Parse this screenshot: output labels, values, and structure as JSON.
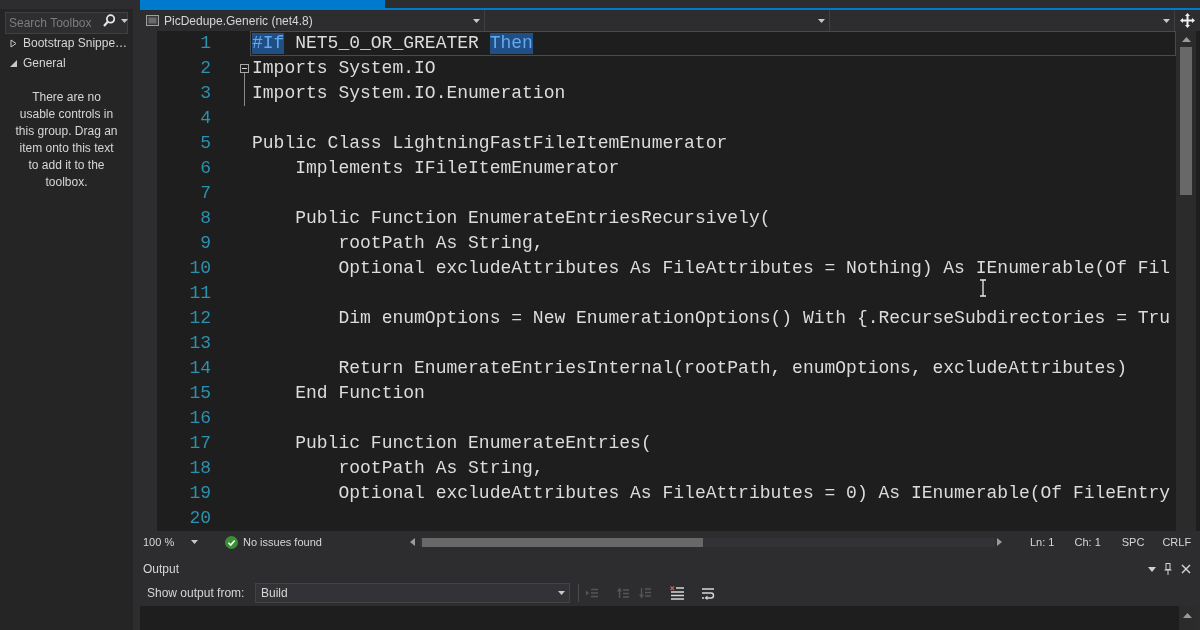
{
  "toolbox": {
    "search": {
      "placeholder": "Search Toolbox"
    },
    "groups": [
      {
        "label": "Bootstrap Snippe…",
        "expanded": false
      },
      {
        "label": "General",
        "expanded": true
      }
    ],
    "empty_message": "There are no usable controls in this group. Drag an item onto this text to add it to the toolbox."
  },
  "navigation_bar": {
    "project": "PicDedupe.Generic (net4.8)"
  },
  "editor": {
    "lines": [
      {
        "number": "1",
        "current": true,
        "segments": [
          {
            "text": "#If",
            "highlighted": true
          },
          {
            "text": "NET5_0_OR_GREATER",
            "highlighted": false
          },
          {
            "text": "Then",
            "highlighted": true
          }
        ]
      },
      {
        "number": "2",
        "current": false,
        "expanded": true,
        "text": "Imports System.IO"
      },
      {
        "number": "3",
        "current": false,
        "text": "Imports System.IO.Enumeration"
      },
      {
        "number": "4",
        "current": false
      },
      {
        "number": "5",
        "current": false,
        "text": "Public Class LightningFastFileItemEnumerator"
      },
      {
        "number": "6",
        "current": false,
        "text": "    Implements IFileItemEnumerator"
      },
      {
        "number": "7",
        "current": false
      },
      {
        "number": "8",
        "current": false,
        "text": "    Public Function EnumerateEntriesRecursively("
      },
      {
        "number": "9",
        "current": false,
        "text": "        rootPath As String,"
      },
      {
        "number": "10",
        "current": false,
        "text": "        Optional excludeAttributes As FileAttributes = Nothing) As IEnumerable(Of Fil"
      },
      {
        "number": "11",
        "current": false
      },
      {
        "number": "12",
        "current": false,
        "text": "        Dim enumOptions = New EnumerationOptions() With {.RecurseSubdirectories = Tru"
      },
      {
        "number": "13",
        "current": false
      },
      {
        "number": "14",
        "current": false,
        "text": "        Return EnumerateEntriesInternal(rootPath, enumOptions, excludeAttributes)"
      },
      {
        "number": "15",
        "current": false,
        "text": "    End Function"
      },
      {
        "number": "16",
        "current": false
      },
      {
        "number": "17",
        "current": false,
        "text": "    Public Function EnumerateEntries("
      },
      {
        "number": "18",
        "current": false,
        "text": "        rootPath As String,"
      },
      {
        "number": "19",
        "current": false,
        "text": "        Optional excludeAttributes As FileAttributes = 0) As IEnumerable(Of FileEntry"
      },
      {
        "number": "20",
        "current": false
      }
    ]
  },
  "editor_status": {
    "zoom": "100 %",
    "issues": "No issues found",
    "line": "Ln: 1",
    "column": "Ch: 1",
    "indentation": "SPC",
    "line_endings": "CRLF"
  },
  "output": {
    "title": "Output",
    "source_label": "Show output from:",
    "source": "Build",
    "toolbar": [
      {
        "kind": "find",
        "disabled": true
      },
      {
        "kind": "previous",
        "disabled": true
      },
      {
        "kind": "next",
        "disabled": true
      },
      {
        "kind": "clear",
        "disabled": false
      },
      {
        "kind": "wrap",
        "disabled": false
      }
    ]
  }
}
